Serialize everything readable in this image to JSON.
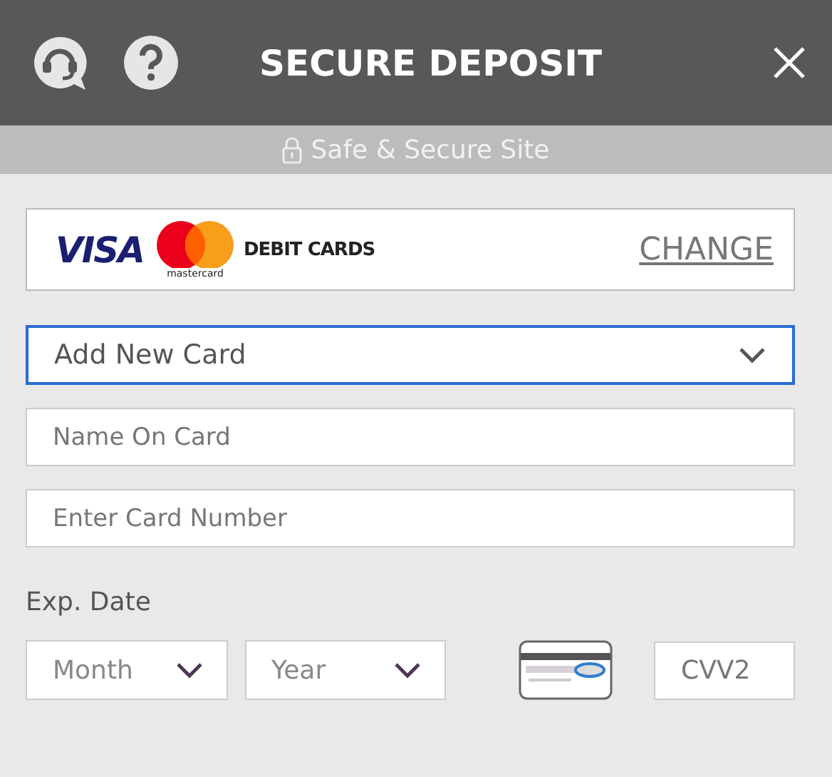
{
  "header": {
    "title": "SECURE DEPOSIT"
  },
  "banner": {
    "text": "Safe & Secure Site"
  },
  "payment_method": {
    "brand_visa": "VISA",
    "brand_mastercard": "mastercard",
    "label": "DEBIT CARDS",
    "change_link": "CHANGE"
  },
  "card_select": {
    "value": "Add New Card",
    "focused": true
  },
  "fields": [
    {
      "placeholder": "Name On Card"
    },
    {
      "placeholder": "Enter Card Number"
    }
  ],
  "expiry": {
    "label": "Exp. Date",
    "selects": [
      {
        "placeholder": "Month"
      },
      {
        "placeholder": "Year"
      }
    ]
  },
  "cvv": {
    "placeholder": "CVV2"
  }
}
